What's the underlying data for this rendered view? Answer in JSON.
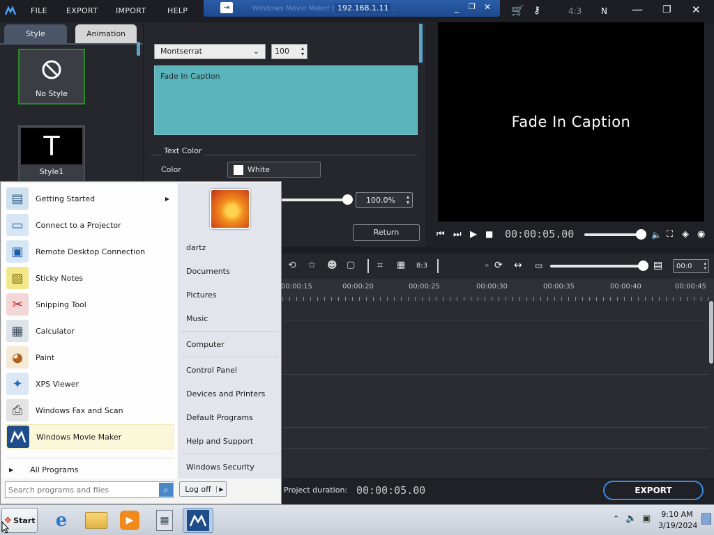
{
  "menu": {
    "file": "FILE",
    "export": "EXPORT",
    "import": "IMPORT",
    "help": "HELP"
  },
  "remote_bar": {
    "address": "192.168.1.11",
    "faint_title": "Windows Movie Maker (FULL) - New Pro..."
  },
  "top_right": {
    "aspect": "4:3",
    "n_label": "N"
  },
  "left_tabs": {
    "style": "Style",
    "animation": "Animation"
  },
  "styles": {
    "no_style": "No Style",
    "style1": "Style1"
  },
  "editor": {
    "font": "Montserrat",
    "size": "100",
    "caption_text": "Fade In Caption",
    "text_color_group": "Text Color",
    "color_label": "Color",
    "color_value": "White",
    "opacity": "100.0%",
    "return_label": "Return"
  },
  "preview": {
    "caption": "Fade In Caption",
    "timecode": "00:00:05.00"
  },
  "timeline": {
    "ratio": "8:3",
    "zoom_field": "00:0",
    "ticks": [
      "00:00:15",
      "00:00:20",
      "00:00:25",
      "00:00:30",
      "00:00:35",
      "00:00:40",
      "00:00:45"
    ]
  },
  "bottom": {
    "project_duration_label": "Project duration:",
    "project_duration": "00:00:05.00",
    "export_label": "EXPORT"
  },
  "start_menu": {
    "programs": [
      "Getting Started",
      "Connect to a Projector",
      "Remote Desktop Connection",
      "Sticky Notes",
      "Snipping Tool",
      "Calculator",
      "Paint",
      "XPS Viewer",
      "Windows Fax and Scan",
      "Windows Movie Maker"
    ],
    "all_programs": "All Programs",
    "search_placeholder": "Search programs and files",
    "places": [
      "dartz",
      "Documents",
      "Pictures",
      "Music",
      "Computer",
      "Control Panel",
      "Devices and Printers",
      "Default Programs",
      "Help and Support",
      "Windows Security"
    ],
    "log_off": "Log off"
  },
  "taskbar": {
    "start": "Start",
    "time": "9:10 AM",
    "date": "3/19/2024"
  },
  "colors": {
    "accent_teal": "#5bb3bc",
    "export_border": "#3a8ee6",
    "selected_green": "#2a8a2a"
  }
}
